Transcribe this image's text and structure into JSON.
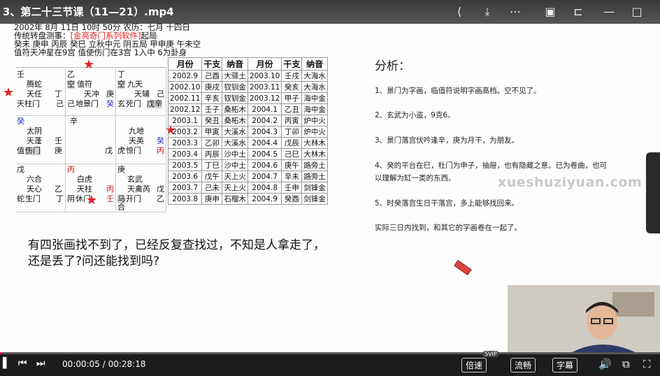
{
  "title": "3、第二十三节课（11—21）.mp4",
  "header": {
    "line1": "2002年 8月 11日 10时 50分 农历：七月 十四日",
    "line2_a": "传统转盘测事：",
    "line2_b": "[金亮奇门系列软件]",
    "line2_c": "起局",
    "line3": "癸未 庚申 丙辰 癸巳 立秋中元 阴五局 甲申庚 午未空",
    "line4": "值符天冲星在9宫 值使伤门在3宫 1入中 6为卦身"
  },
  "palaces": [
    {
      "id": "sw",
      "l1": "壬",
      "l2": "腾蛇",
      "l3a": "天任",
      "l3b": "丁",
      "l4a": "天柱门",
      "l4b": "己"
    },
    {
      "id": "s",
      "l1": "乙",
      "l2a": "空",
      "l2b": "值符",
      "l3a": "天冲",
      "l3b": "庚",
      "l4a": "己",
      "l4b": "地景门",
      "l4c": "癸"
    },
    {
      "id": "se",
      "l1": "丁",
      "l2a": "空",
      "l2b": "九天",
      "l3a": "天辅",
      "l3b": "己",
      "l4a": "玄",
      "l4b": "死门",
      "l4c": "戊辛"
    },
    {
      "id": "w",
      "l1": "癸",
      "l2": "太阴",
      "l3a": "天蓬",
      "l3b": "壬",
      "l4a": "值",
      "l4b": "伤门",
      "l4c": "庚"
    },
    {
      "id": "c",
      "l1": "辛",
      "l4": "戊"
    },
    {
      "id": "e",
      "l2": "九地",
      "l3a": "天英",
      "l3b": "癸",
      "l4a": "虎",
      "l4b": "惊门",
      "l4c": "丙"
    },
    {
      "id": "nw",
      "l1": "戊",
      "l2": "六合",
      "l3a": "天心",
      "l3b": "乙",
      "l4a": "蛇",
      "l4b": "生门",
      "l4c": "丁"
    },
    {
      "id": "n",
      "l1": "丙",
      "l2": "白虎",
      "l3a": "天柱",
      "l3b": "丙",
      "l4a": "阴",
      "l4b": "休门",
      "l4c": "壬"
    },
    {
      "id": "ne",
      "l1": "庚",
      "l2": "玄武",
      "l3a": "天禽芮",
      "l3b": "戊",
      "l4a": "马",
      "l4b": "合",
      "l4c": "开门",
      "l4d": "乙"
    }
  ],
  "calendar": {
    "headers": [
      "月份",
      "干支",
      "纳音",
      "月份",
      "干支",
      "纳音"
    ],
    "rows": [
      [
        "2002.9",
        "己酉",
        "大驿土",
        "2003.10",
        "壬戌",
        "大海水"
      ],
      [
        "2002.10",
        "庚戌",
        "钗钏金",
        "2003.11",
        "癸亥",
        "大海水"
      ],
      [
        "2002.11",
        "辛亥",
        "钗钏金",
        "2003.12",
        "甲子",
        "海中金"
      ],
      [
        "2002.12",
        "壬子",
        "桑柘木",
        "2004.1",
        "乙丑",
        "海中金"
      ],
      [
        "2003.1",
        "癸丑",
        "桑柘木",
        "2004.2",
        "丙寅",
        "炉中火"
      ],
      [
        "2003.2",
        "甲寅",
        "大溪水",
        "2004.3",
        "丁卯",
        "炉中火"
      ],
      [
        "2003.3",
        "乙卯",
        "大溪水",
        "2004.4",
        "戊辰",
        "大林木"
      ],
      [
        "2003.4",
        "丙辰",
        "沙中土",
        "2004.5",
        "己巳",
        "大林木"
      ],
      [
        "2003.5",
        "丁巳",
        "沙中土",
        "2004.6",
        "庚午",
        "路旁土"
      ],
      [
        "2003.6",
        "戊午",
        "天上火",
        "2004.7",
        "辛未",
        "路旁土"
      ],
      [
        "2003.7",
        "己未",
        "天上火",
        "2004.8",
        "壬申",
        "剑锋金"
      ],
      [
        "2003.8",
        "庚申",
        "石榴木",
        "2004.9",
        "癸酉",
        "剑锋金"
      ]
    ]
  },
  "analysis": {
    "heading": "分析：",
    "items": [
      "1、景门为字画，临值符说明字画高档。空不见了。",
      "2、玄武为小盗，9克6。",
      "3、景门落宫伏吟逢辛，庚为月干，为朋友。",
      "4、癸的平台在巳，杜门为申子，抽屉，也有隐藏之意。已为卷曲，也可",
      "以理解为缸一类的东西。",
      "5、时癸落宫生日干落宫，多上能够找回来。",
      "实际三日内找到，和其它的字画卷在一起了。"
    ]
  },
  "question": "有四张画找不到了，已经反复查找过，不知是人拿走了，还是丢了?问还能找到吗?",
  "watermark": "xueshuziyuan.com",
  "player": {
    "current": "00:00:05",
    "separator": " / ",
    "duration": "00:28:18",
    "progress": 0.003,
    "speed_label": "倍速",
    "svip": "SVIP",
    "quality_label": "流畅",
    "subtitle_label": "字幕"
  },
  "colors": {
    "accent": "#ff0033",
    "star": "#e02020",
    "link_red": "#dd2222"
  }
}
